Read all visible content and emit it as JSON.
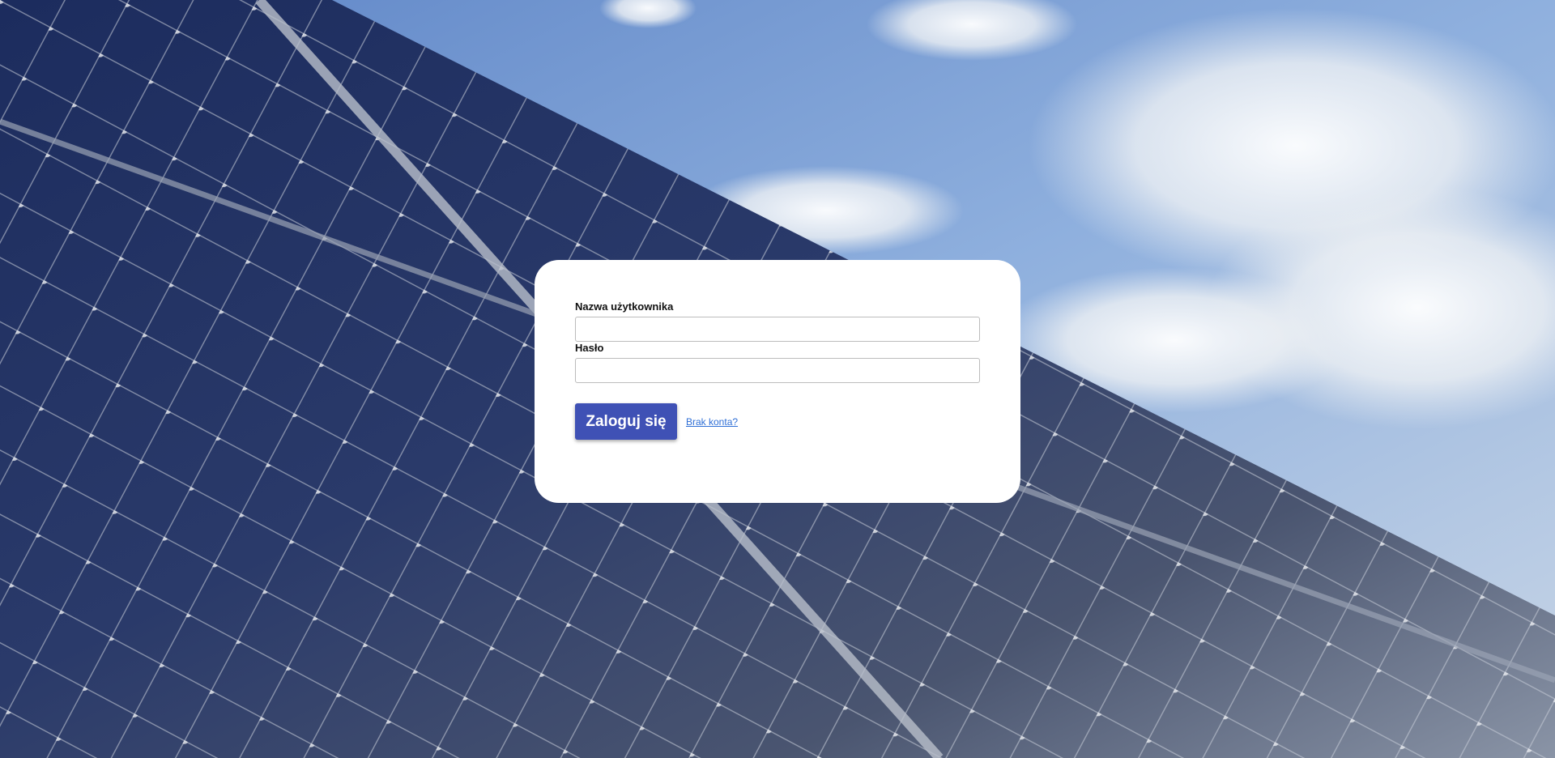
{
  "background": {
    "description_icon": "solar-panels-sky-photo",
    "sky_color": "#7fa3d6",
    "panel_color": "#24335a"
  },
  "login_form": {
    "username_label": "Nazwa użytkownika",
    "username_value": "",
    "password_label": "Hasło",
    "password_value": "",
    "submit_label": "Zaloguj się",
    "signup_link": "Brak konta?",
    "accent_color": "#3f51b5"
  }
}
